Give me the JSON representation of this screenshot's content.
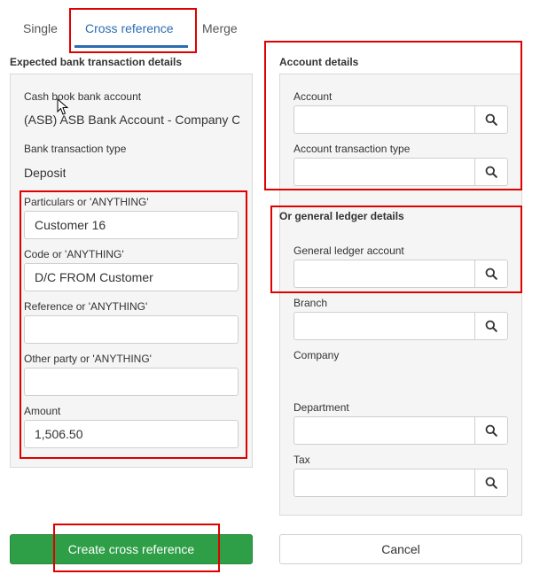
{
  "tabs": {
    "single": "Single",
    "cross_reference": "Cross reference",
    "merge": "Merge"
  },
  "expected": {
    "section_title": "Expected bank transaction details",
    "cash_book_label": "Cash book bank account",
    "cash_book_value": "(ASB) ASB Bank Account - Company C",
    "txn_type_label": "Bank transaction type",
    "txn_type_value": "Deposit",
    "particulars_label": "Particulars or 'ANYTHING'",
    "particulars_value": "Customer 16",
    "code_label": "Code or 'ANYTHING'",
    "code_value": "D/C FROM Customer",
    "reference_label": "Reference or 'ANYTHING'",
    "reference_value": "",
    "other_party_label": "Other party or 'ANYTHING'",
    "other_party_value": "",
    "amount_label": "Amount",
    "amount_value": "1,506.50"
  },
  "account": {
    "section_title": "Account details",
    "account_label": "Account",
    "account_value": "",
    "account_txn_type_label": "Account transaction type",
    "account_txn_type_value": ""
  },
  "gl": {
    "section_title": "Or general ledger details",
    "gl_account_label": "General ledger account",
    "gl_account_value": "",
    "branch_label": "Branch",
    "company_label": "Company",
    "department_label": "Department",
    "tax_label": "Tax"
  },
  "actions": {
    "create_label": "Create cross reference",
    "cancel_label": "Cancel"
  },
  "colors": {
    "accent": "#2b6cb0",
    "primary_button": "#2e9e47",
    "highlight": "#e00000"
  },
  "icons": {
    "search": "search-icon",
    "cursor": "mouse-cursor-icon"
  }
}
